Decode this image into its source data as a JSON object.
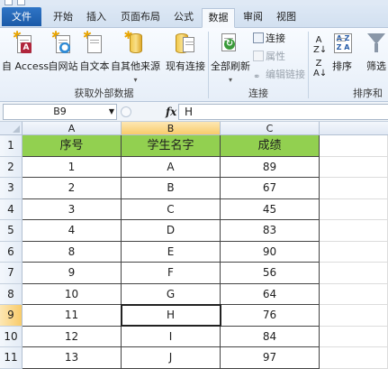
{
  "tabs": {
    "file": "文件",
    "items": [
      "开始",
      "插入",
      "页面布局",
      "公式",
      "数据",
      "审阅",
      "视图"
    ],
    "active": "数据"
  },
  "ribbon": {
    "external_data": {
      "buttons": [
        "自 Access",
        "自网站",
        "自文本",
        "自其他来源",
        "现有连接"
      ],
      "group_label": "获取外部数据"
    },
    "connections": {
      "refresh_all": "全部刷新",
      "connections": "连接",
      "properties": "属性",
      "edit_links": "编辑链接",
      "group_label": "连接"
    },
    "sort_filter": {
      "sort": "排序",
      "filter": "筛选",
      "group_label": "排序和"
    }
  },
  "formula_bar": {
    "name_box": "B9",
    "fx": "fx",
    "content": "H"
  },
  "sheet": {
    "columns": [
      "A",
      "B",
      "C"
    ],
    "selected_column": "B",
    "selected_row": "9",
    "headers": [
      "序号",
      "学生名字",
      "成绩"
    ],
    "row_numbers": [
      "1",
      "2",
      "3",
      "4",
      "5",
      "6",
      "7",
      "8",
      "9",
      "10",
      "11"
    ],
    "rows": [
      [
        "1",
        "A",
        "89"
      ],
      [
        "2",
        "B",
        "67"
      ],
      [
        "3",
        "C",
        "45"
      ],
      [
        "4",
        "D",
        "83"
      ],
      [
        "8",
        "E",
        "90"
      ],
      [
        "9",
        "F",
        "56"
      ],
      [
        "10",
        "G",
        "64"
      ],
      [
        "11",
        "H",
        "76"
      ],
      [
        "12",
        "I",
        "84"
      ],
      [
        "13",
        "J",
        "97"
      ]
    ]
  },
  "colors": {
    "header_fill": "#92d050",
    "selection_header": "#f8cb6a",
    "file_tab": "#1b5aa8"
  }
}
